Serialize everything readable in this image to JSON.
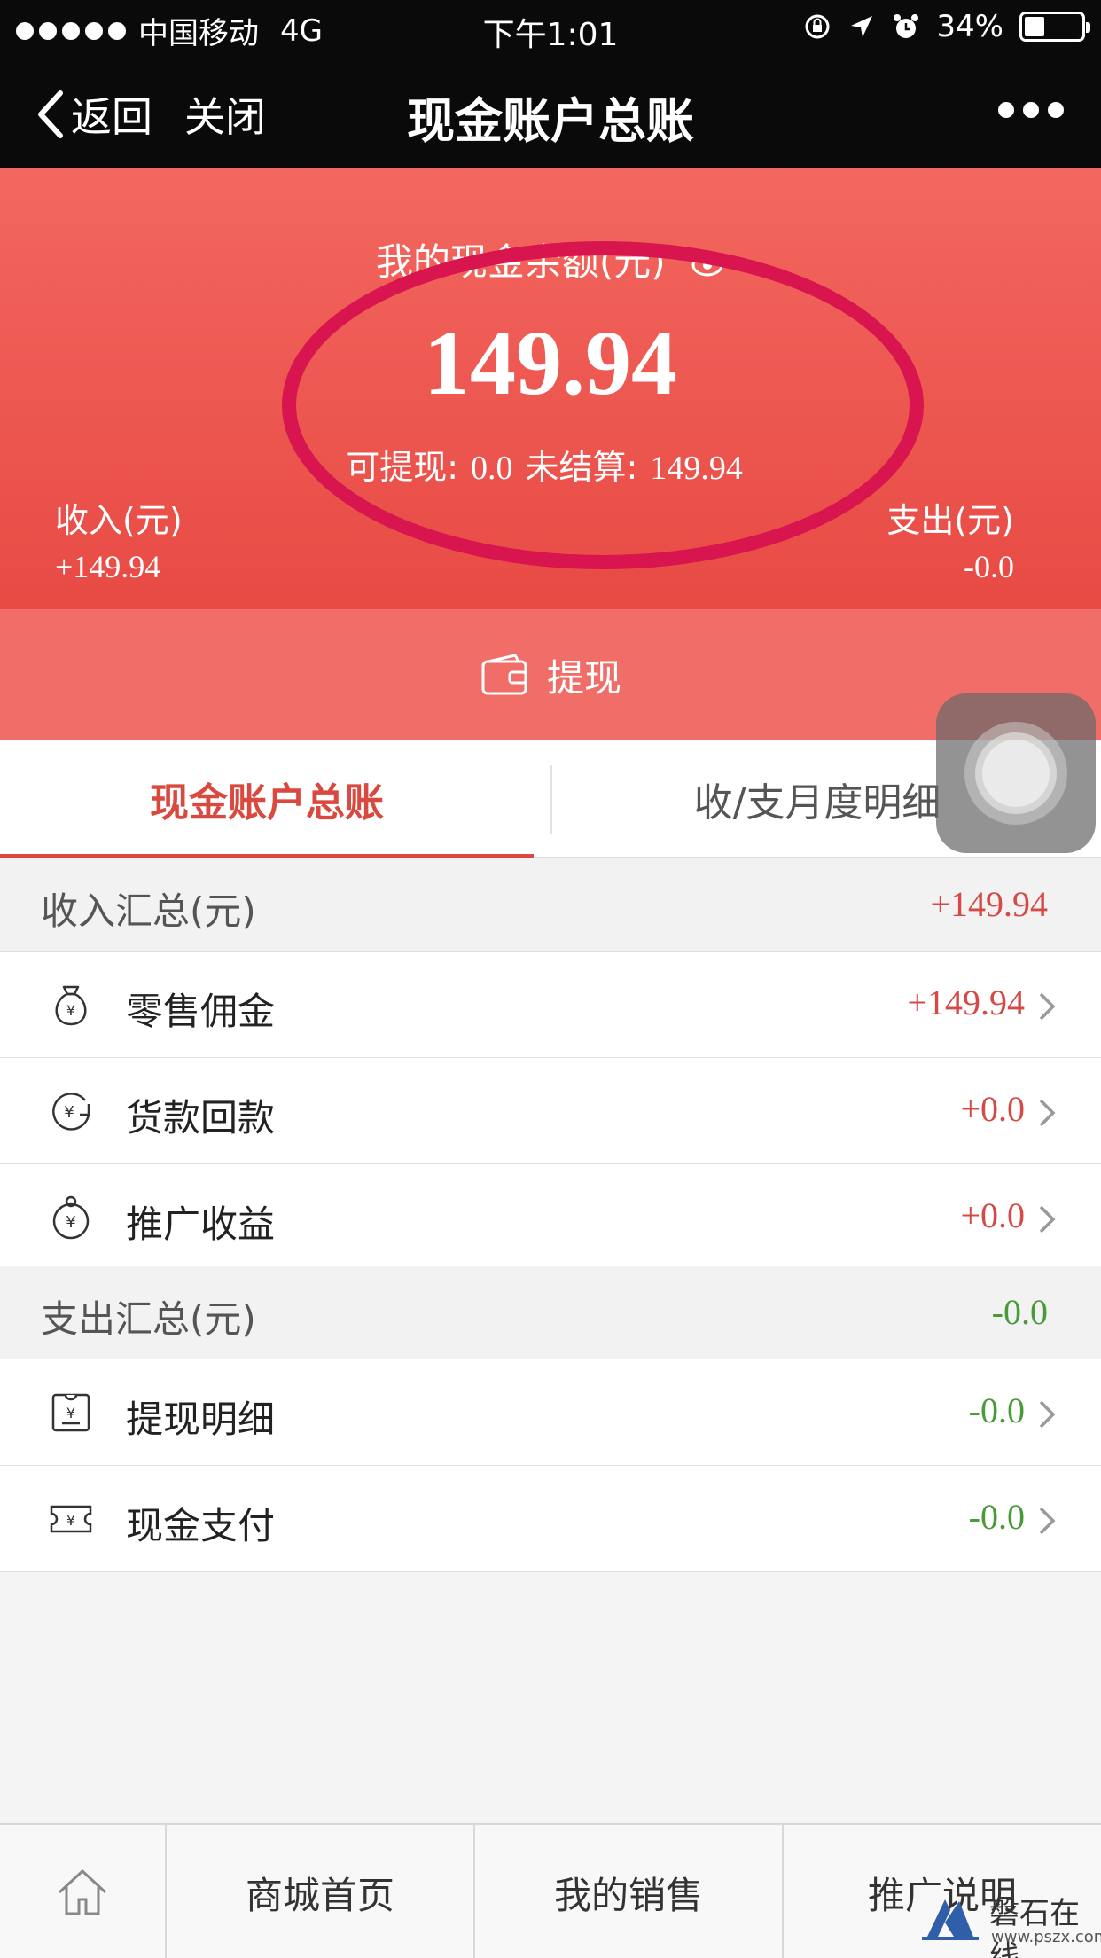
{
  "status_bar": {
    "carrier": "中国移动",
    "network": "4G",
    "time": "下午1:01",
    "battery": "34%"
  },
  "nav": {
    "back_label": "返回",
    "close_label": "关闭",
    "title": "现金账户总账"
  },
  "hero": {
    "balance_label": "我的现金余额(元)",
    "balance": "149.94",
    "withdrawable_label": "可提现:",
    "withdrawable_value": "0.0",
    "unsettled_label": "未结算:",
    "unsettled_value": "149.94",
    "income_label": "收入(元)",
    "income_value": "+149.94",
    "expense_label": "支出(元)",
    "expense_value": "-0.0"
  },
  "withdraw_button": "提现",
  "tabs": [
    {
      "label": "现金账户总账",
      "active": true
    },
    {
      "label": "收/支月度明细",
      "active": false
    }
  ],
  "income_section": {
    "label": "收入汇总(元)",
    "total": "+149.94",
    "items": [
      {
        "label": "零售佣金",
        "value": "+149.94",
        "icon": "money-bag-icon"
      },
      {
        "label": "货款回款",
        "value": "+0.0",
        "icon": "yuan-return-icon"
      },
      {
        "label": "推广收益",
        "value": "+0.0",
        "icon": "yuan-bag-icon"
      }
    ]
  },
  "expense_section": {
    "label": "支出汇总(元)",
    "total": "-0.0",
    "items": [
      {
        "label": "提现明细",
        "value": "-0.0",
        "icon": "receipt-icon"
      },
      {
        "label": "现金支付",
        "value": "-0.0",
        "icon": "ticket-icon"
      }
    ]
  },
  "bottom_bar": {
    "home_icon": "home-icon",
    "items": [
      "商城首页",
      "我的销售",
      "推广说明"
    ]
  },
  "watermark": {
    "text": "磐石在线",
    "url": "www.pszx.com"
  },
  "colors": {
    "hero_red": "#e84a44",
    "income_red": "#d34a46",
    "expense_green": "#4b9a3a",
    "highlight_ellipse": "#d8154e"
  }
}
